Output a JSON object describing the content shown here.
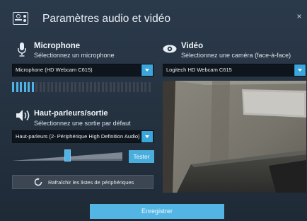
{
  "dialog": {
    "title": "Paramètres audio et vidéo",
    "close_glyph": "×"
  },
  "microphone": {
    "heading": "Microphone",
    "subheading": "Sélectionnez un microphone",
    "selected_device": "Microphone (HD Webcam C615)",
    "icon": "microphone-icon",
    "level_fraction": 0.18
  },
  "video": {
    "heading": "Vidéo",
    "subheading": "Sélectionnez une caméra (face-à-face)",
    "selected_device": "Logitech HD Webcam C615",
    "icon": "camera-eye-icon"
  },
  "speakers": {
    "heading": "Haut-parleurs/sortie",
    "subheading": "Sélectionnez une sortie par défaut",
    "selected_device": "Haut-parleurs (2- Périphérique High Definition Audio)",
    "icon": "speaker-icon",
    "volume_fraction": 0.5,
    "test_label": "Tester"
  },
  "actions": {
    "refresh_label": "Rafraîchir les listes de périphériques",
    "save_label": "Enregistrer"
  },
  "colors": {
    "accent": "#4aaedd",
    "background": "#24313f",
    "meter_on": "#4fb3e6",
    "meter_off": "#3b4450"
  }
}
